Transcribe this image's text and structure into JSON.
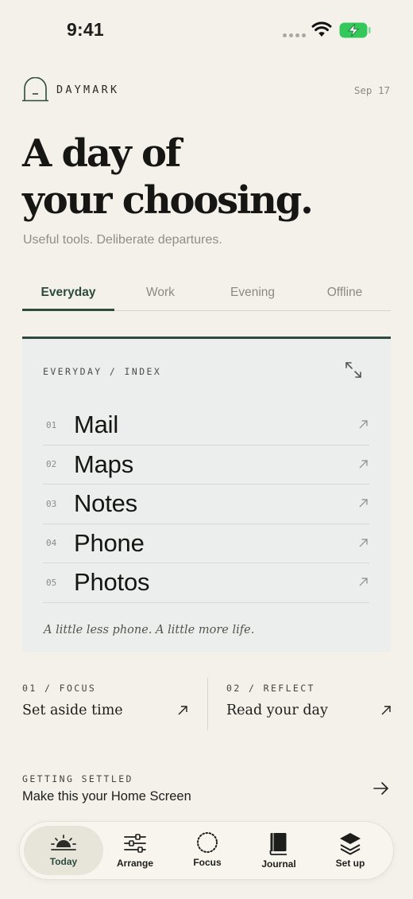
{
  "status_bar": {
    "time": "9:41"
  },
  "header": {
    "brand": "DAYMARK",
    "date": "Sep 17"
  },
  "hero": {
    "title_line1": "A day of",
    "title_line2": "your choosing.",
    "subtitle": "Useful tools. Deliberate departures."
  },
  "tabs": [
    {
      "label": "Everyday",
      "active": true
    },
    {
      "label": "Work",
      "active": false
    },
    {
      "label": "Evening",
      "active": false
    },
    {
      "label": "Offline",
      "active": false
    }
  ],
  "index": {
    "label": "EVERYDAY / INDEX",
    "items": [
      {
        "num": "01",
        "name": "Mail"
      },
      {
        "num": "02",
        "name": "Maps"
      },
      {
        "num": "03",
        "name": "Notes"
      },
      {
        "num": "04",
        "name": "Phone"
      },
      {
        "num": "05",
        "name": "Photos"
      }
    ],
    "tagline": "A little less phone. A little more life."
  },
  "features": [
    {
      "kicker": "01 / FOCUS",
      "title": "Set aside time"
    },
    {
      "kicker": "02 / REFLECT",
      "title": "Read your day"
    }
  ],
  "getting_settled": {
    "kicker": "GETTING SETTLED",
    "title": "Make this your Home Screen"
  },
  "tab_bar": [
    {
      "label": "Today",
      "icon": "sunrise-icon",
      "active": true
    },
    {
      "label": "Arrange",
      "icon": "sliders-icon",
      "active": false
    },
    {
      "label": "Focus",
      "icon": "dotted-circle-icon",
      "active": false
    },
    {
      "label": "Journal",
      "icon": "book-icon",
      "active": false
    },
    {
      "label": "Set up",
      "icon": "layers-icon",
      "active": false
    }
  ],
  "colors": {
    "background": "#f4f1ea",
    "accent": "#2d4a3c",
    "card": "#eceeed",
    "battery": "#34c759"
  }
}
